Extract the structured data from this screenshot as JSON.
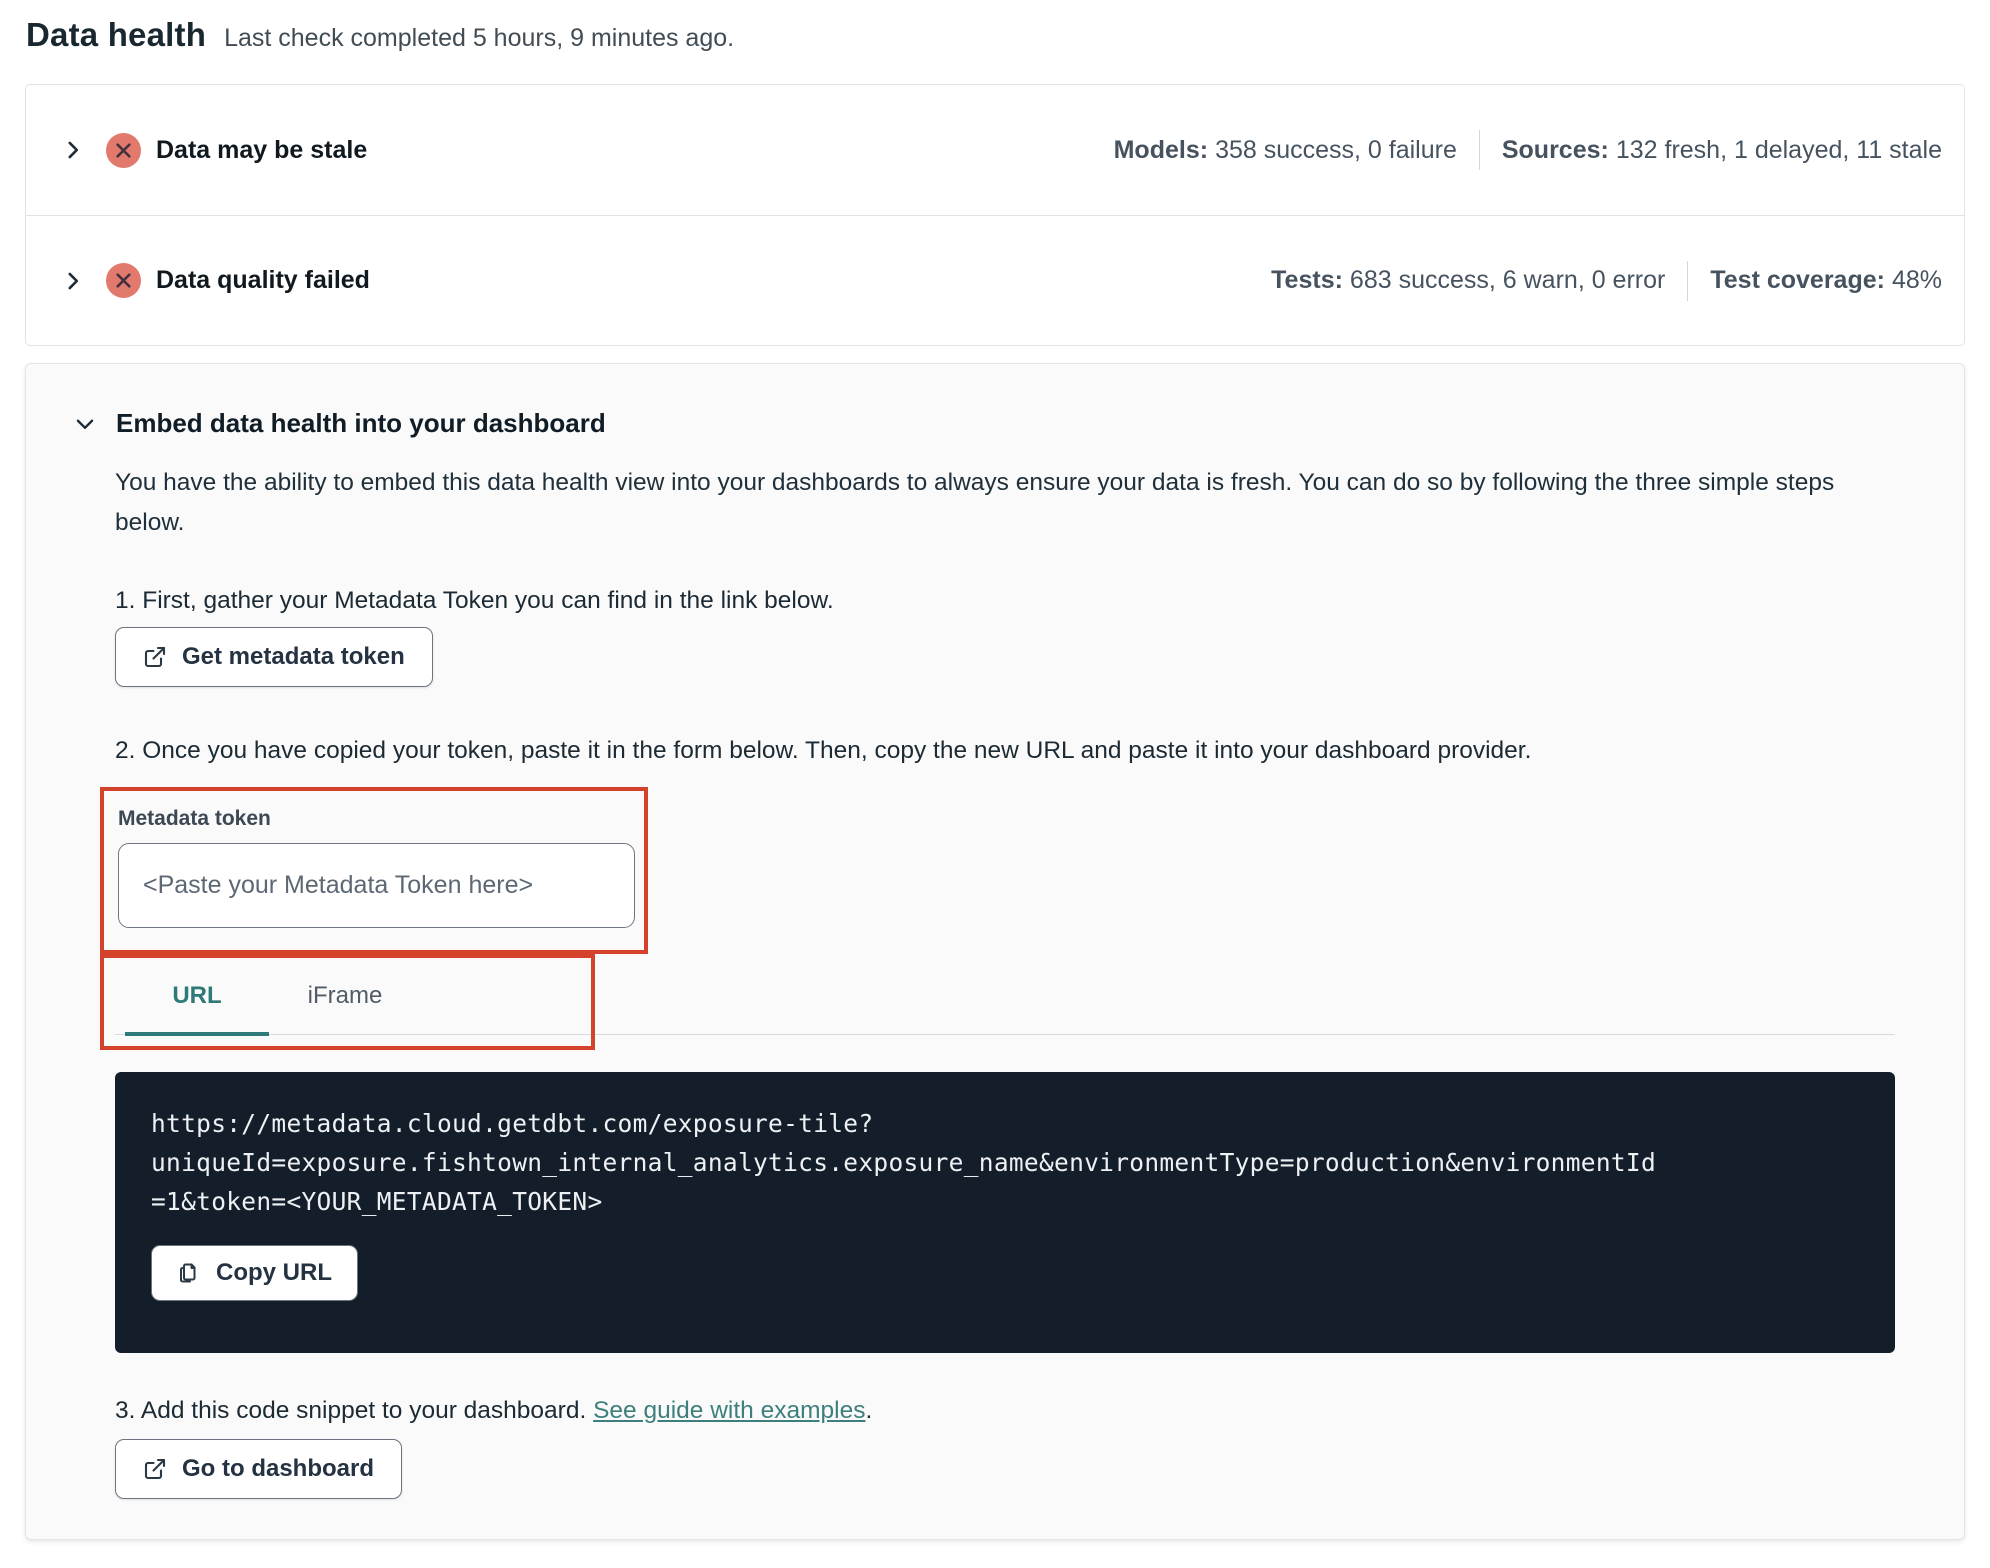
{
  "header": {
    "title": "Data health",
    "subtitle": "Last check completed 5 hours, 9 minutes ago."
  },
  "status_rows": [
    {
      "label": "Data may be stale",
      "status_icon": "x-circle-icon",
      "stats": [
        {
          "label": "Models:",
          "value": "358 success, 0 failure"
        },
        {
          "label": "Sources:",
          "value": "132 fresh, 1 delayed, 11 stale"
        }
      ]
    },
    {
      "label": "Data quality failed",
      "status_icon": "x-circle-icon",
      "stats": [
        {
          "label": "Tests:",
          "value": "683 success, 6 warn, 0 error"
        },
        {
          "label": "Test coverage:",
          "value": "48%"
        }
      ]
    }
  ],
  "embed": {
    "title": "Embed data health into your dashboard",
    "description": "You have the ability to embed this data health view into your dashboards to always ensure your data is fresh. You can do so by following the three simple steps below.",
    "step1": {
      "text": "1. First, gather your Metadata Token you can find in the link below.",
      "button_label": "Get metadata token"
    },
    "step2": {
      "text": "2. Once you have copied your token, paste it in the form below. Then, copy the new URL and paste it into your dashboard provider.",
      "token_label": "Metadata token",
      "token_placeholder": "<Paste your Metadata Token here>",
      "token_value": "",
      "tabs": [
        {
          "label": "URL",
          "active": true
        },
        {
          "label": "iFrame",
          "active": false
        }
      ],
      "code_lines": [
        "https://metadata.cloud.getdbt.com/exposure-tile?",
        "uniqueId=exposure.fishtown_internal_analytics.exposure_name&environmentType=production&environmentId",
        "=1&token=<YOUR_METADATA_TOKEN>"
      ],
      "copy_button_label": "Copy URL"
    },
    "step3": {
      "text_before_link": "3. Add this code snippet to your dashboard. ",
      "link_text": "See guide with examples",
      "text_after_link": ".",
      "button_label": "Go to dashboard"
    }
  },
  "colors": {
    "accent_teal": "#2d7a78",
    "annotation_red": "#d5422c",
    "status_fail_salmon": "#e2796d",
    "code_background": "#141e2b",
    "panel_background": "#fafafb"
  }
}
